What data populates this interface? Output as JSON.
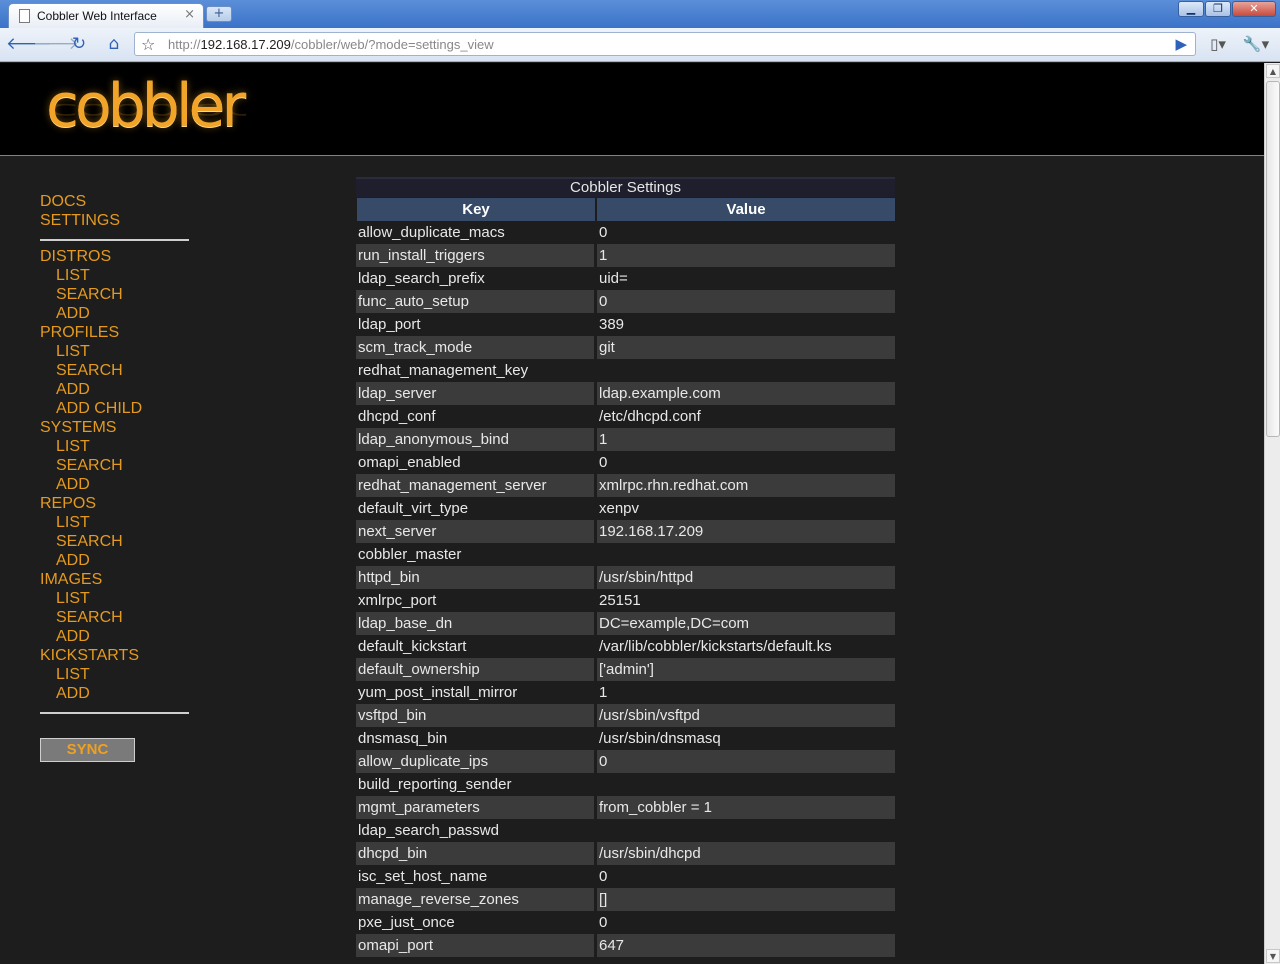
{
  "browser": {
    "tab_title": "Cobbler Web Interface",
    "tab_close": "×",
    "new_tab": "+",
    "url_prefix": "http://",
    "url_host": "192.168.17.209",
    "url_path": "/cobbler/web/?mode=settings_view",
    "window_buttons": [
      "▁",
      "❐",
      "✕"
    ]
  },
  "header": {
    "logo_text": "cobbler"
  },
  "sidebar": {
    "groups": [
      {
        "items": [
          {
            "label": "DOCS",
            "level": "section"
          },
          {
            "label": "SETTINGS",
            "level": "section"
          }
        ]
      },
      {
        "items": [
          {
            "label": "DISTROS",
            "level": "section"
          },
          {
            "label": "LIST",
            "level": "sub"
          },
          {
            "label": "SEARCH",
            "level": "sub"
          },
          {
            "label": "ADD",
            "level": "sub"
          },
          {
            "label": "PROFILES",
            "level": "section"
          },
          {
            "label": "LIST",
            "level": "sub"
          },
          {
            "label": "SEARCH",
            "level": "sub"
          },
          {
            "label": "ADD",
            "level": "sub"
          },
          {
            "label": "ADD CHILD",
            "level": "sub"
          },
          {
            "label": "SYSTEMS",
            "level": "section"
          },
          {
            "label": "LIST",
            "level": "sub"
          },
          {
            "label": "SEARCH",
            "level": "sub"
          },
          {
            "label": "ADD",
            "level": "sub"
          },
          {
            "label": "REPOS",
            "level": "section"
          },
          {
            "label": "LIST",
            "level": "sub"
          },
          {
            "label": "SEARCH",
            "level": "sub"
          },
          {
            "label": "ADD",
            "level": "sub"
          },
          {
            "label": "IMAGES",
            "level": "section"
          },
          {
            "label": "LIST",
            "level": "sub"
          },
          {
            "label": "SEARCH",
            "level": "sub"
          },
          {
            "label": "ADD",
            "level": "sub"
          },
          {
            "label": "KICKSTARTS",
            "level": "section"
          },
          {
            "label": "LIST",
            "level": "sub"
          },
          {
            "label": "ADD",
            "level": "sub"
          }
        ]
      }
    ],
    "sync_label": "SYNC"
  },
  "settings_table": {
    "caption": "Cobbler Settings",
    "col_key": "Key",
    "col_value": "Value",
    "rows": [
      [
        "allow_duplicate_macs",
        "0"
      ],
      [
        "run_install_triggers",
        "1"
      ],
      [
        "ldap_search_prefix",
        "uid="
      ],
      [
        "func_auto_setup",
        "0"
      ],
      [
        "ldap_port",
        "389"
      ],
      [
        "scm_track_mode",
        "git"
      ],
      [
        "redhat_management_key",
        ""
      ],
      [
        "ldap_server",
        "ldap.example.com"
      ],
      [
        "dhcpd_conf",
        "/etc/dhcpd.conf"
      ],
      [
        "ldap_anonymous_bind",
        "1"
      ],
      [
        "omapi_enabled",
        "0"
      ],
      [
        "redhat_management_server",
        "xmlrpc.rhn.redhat.com"
      ],
      [
        "default_virt_type",
        "xenpv"
      ],
      [
        "next_server",
        "192.168.17.209"
      ],
      [
        "cobbler_master",
        ""
      ],
      [
        "httpd_bin",
        "/usr/sbin/httpd"
      ],
      [
        "xmlrpc_port",
        "25151"
      ],
      [
        "ldap_base_dn",
        "DC=example,DC=com"
      ],
      [
        "default_kickstart",
        "/var/lib/cobbler/kickstarts/default.ks"
      ],
      [
        "default_ownership",
        "['admin']"
      ],
      [
        "yum_post_install_mirror",
        "1"
      ],
      [
        "vsftpd_bin",
        "/usr/sbin/vsftpd"
      ],
      [
        "dnsmasq_bin",
        "/usr/sbin/dnsmasq"
      ],
      [
        "allow_duplicate_ips",
        "0"
      ],
      [
        "build_reporting_sender",
        ""
      ],
      [
        "mgmt_parameters",
        "from_cobbler = 1"
      ],
      [
        "ldap_search_passwd",
        ""
      ],
      [
        "dhcpd_bin",
        "/usr/sbin/dhcpd"
      ],
      [
        "isc_set_host_name",
        "0"
      ],
      [
        "manage_reverse_zones",
        "[]"
      ],
      [
        "pxe_just_once",
        "0"
      ],
      [
        "omapi_port",
        "647"
      ]
    ]
  },
  "colors": {
    "accent": "#e59a1f",
    "header_bg": "#000000",
    "page_bg": "#1d1d1d",
    "table_header": "#374a68",
    "row_alt": "#3b3b3b"
  }
}
